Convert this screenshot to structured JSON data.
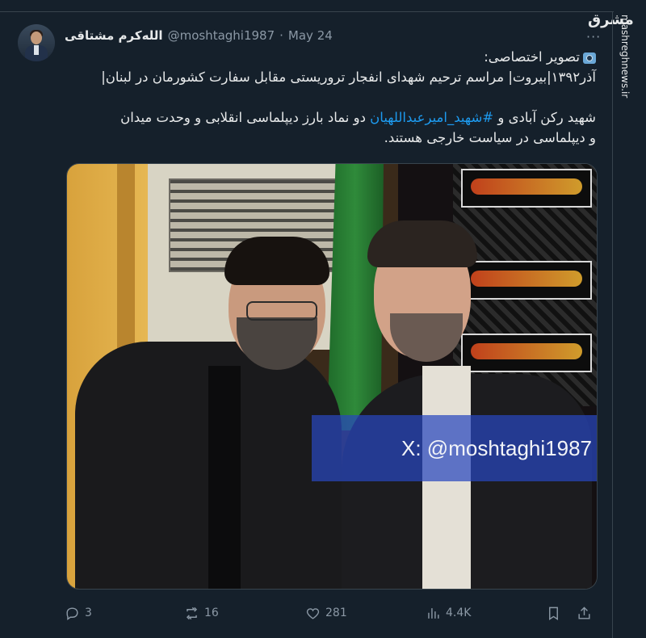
{
  "tweet": {
    "author_name": "الله‌کرم مشتاقی",
    "handle": "@moshtaghi1987",
    "separator": "·",
    "date": "May 24",
    "more_label": "···",
    "lines": [
      "تصویر اختصاصی:",
      "آذر۱۳۹۲|بیروت| مراسم ترحیم شهدای انفجار تروریستی مقابل سفارت کشورمان در لبنان|",
      "",
      "شهید رکن آبادی و",
      "#شهید_امیرعبداللهیان",
      "دو نماد بارز دیپلماسی انقلابی و وحدت میدان",
      "و دیپلماسی در سیاست خارجی هستند."
    ],
    "image_watermark": "X: @moshtaghi1987"
  },
  "actions": {
    "replies": "3",
    "reposts": "16",
    "likes": "281",
    "views": "4.4K"
  },
  "brand": {
    "logo_text": "مشرق",
    "site_url": "mashreghnews.ir"
  },
  "icons": [
    "camera-icon",
    "reply-icon",
    "repost-icon",
    "like-icon",
    "views-icon",
    "bookmark-icon",
    "share-icon"
  ],
  "colors": {
    "background": "#15202b",
    "text": "#e7e9ea",
    "muted": "#8b98a5",
    "link": "#1d9bf0",
    "divider": "#38444d"
  }
}
